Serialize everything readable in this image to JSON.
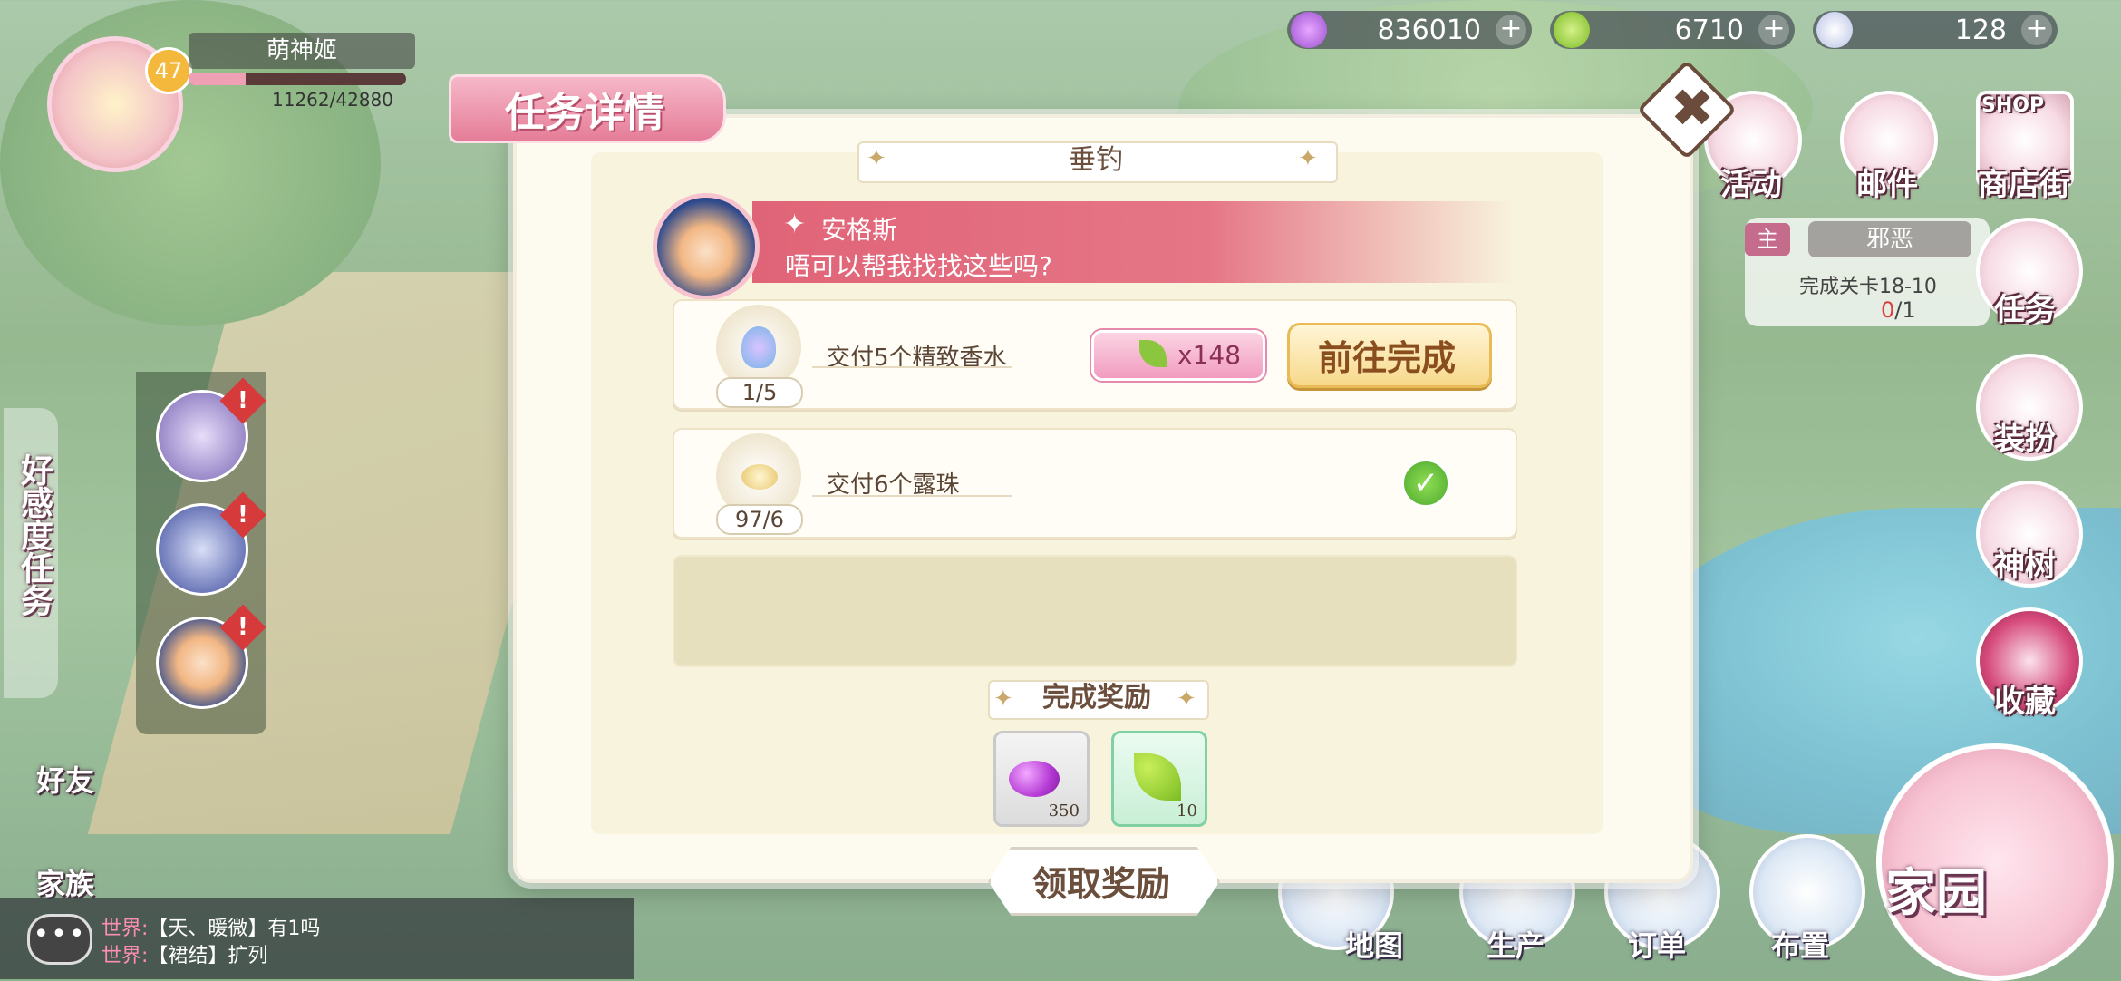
{
  "currencies": [
    {
      "name": "gem-currency",
      "value": "836010",
      "color": "#9b4fd0"
    },
    {
      "name": "leaf-currency",
      "value": "6710",
      "color": "#8cc63f"
    },
    {
      "name": "pearl-currency",
      "value": "128",
      "color": "#b9c3e6"
    }
  ],
  "player": {
    "name": "萌神姬",
    "level": "47",
    "exp_text": "11262/42880",
    "exp_fraction": 0.263
  },
  "side_right": {
    "activity": "活动",
    "mail": "邮件",
    "shop": "商店街",
    "shop_sign": "SHOP",
    "task": "任务",
    "dress": "装扮",
    "tree": "神树",
    "collect": "收藏",
    "home": "家园"
  },
  "main_task": {
    "tag": "主",
    "title": "邪恶",
    "desc": "完成关卡18-10",
    "progress_done": "0",
    "progress_total": "/1"
  },
  "left": {
    "favor_task": "好感度任务",
    "friend": "好友",
    "family": "家族",
    "alert": "!"
  },
  "chat": {
    "icon_text": "•••",
    "lines": [
      {
        "channel": "世界:",
        "text": "【天、暖微】有1吗"
      },
      {
        "channel": "世界:",
        "text": "【裙结】扩列"
      }
    ]
  },
  "bottom_nav": {
    "map": "地图",
    "produce": "生产",
    "order": "订单",
    "layout": "布置"
  },
  "dialog": {
    "title": "任务详情",
    "close_symbol": "✖",
    "subtitle": "垂钓",
    "npc_name": "安格斯",
    "npc_line": "唔可以帮我找找这些吗?",
    "tasks": [
      {
        "desc": "交付5个精致香水",
        "count": "1/5",
        "reward": "x148",
        "button": "前往完成"
      },
      {
        "desc": "交付6个露珠",
        "count": "97/6",
        "done_mark": "✓"
      }
    ],
    "reward_title": "完成奖励",
    "rewards": [
      {
        "name": "gem",
        "count": "350"
      },
      {
        "name": "leaf",
        "count": "10"
      }
    ],
    "claim_button": "领取奖励"
  }
}
